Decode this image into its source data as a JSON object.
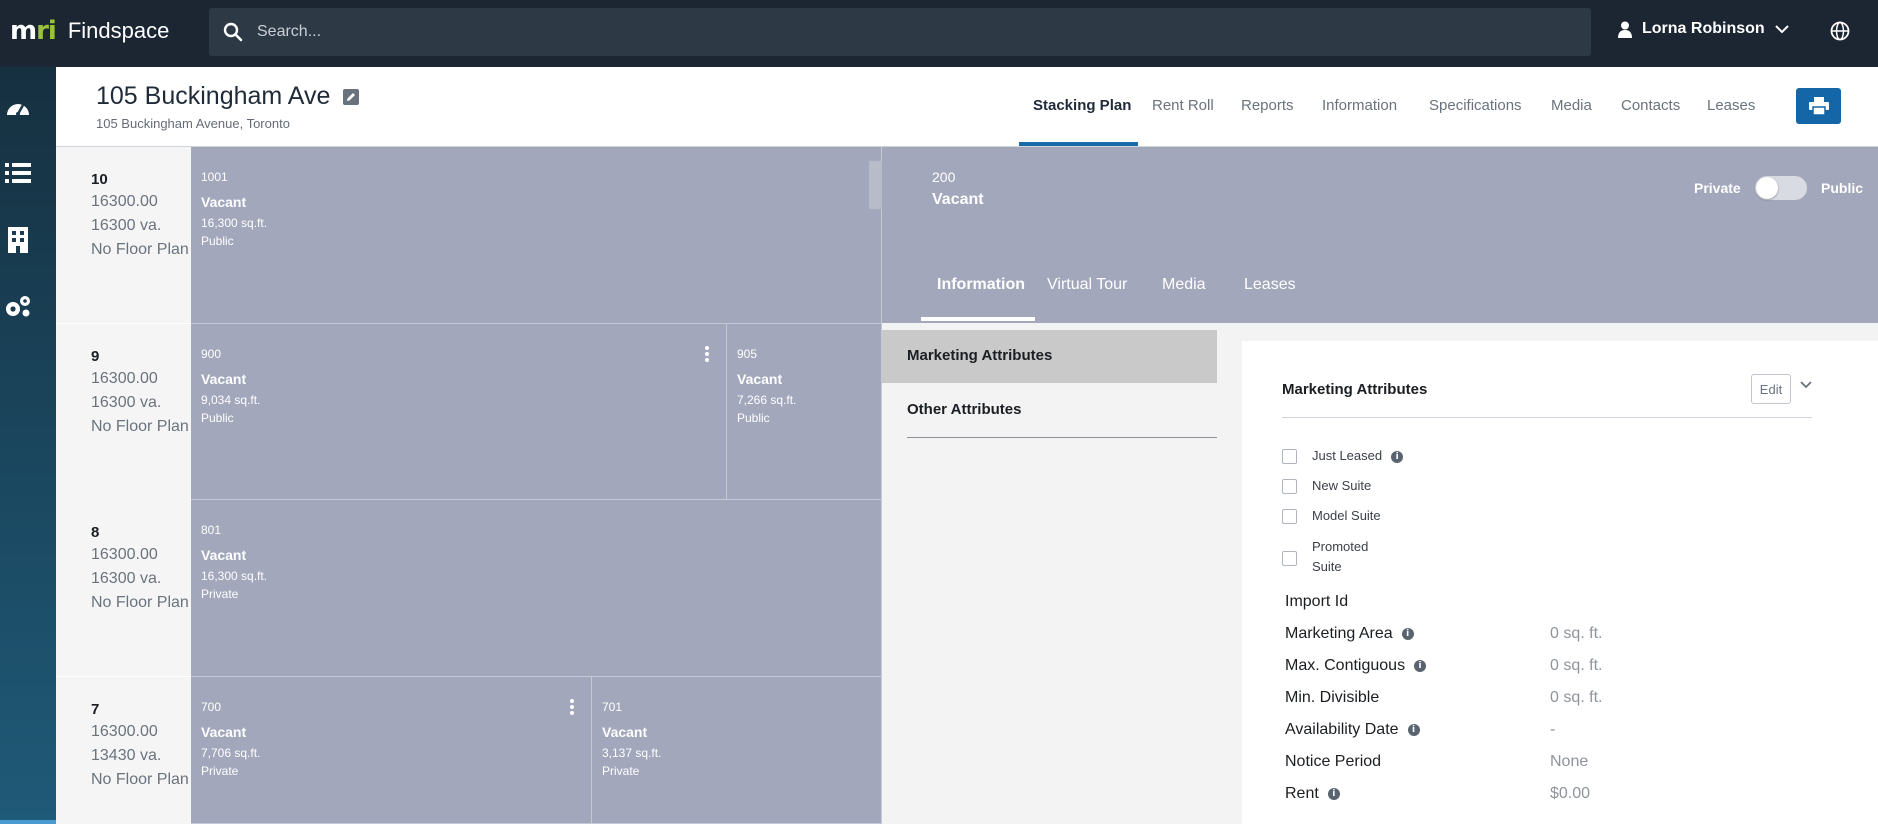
{
  "app": {
    "logo_mark": "mri",
    "name": "Findspace"
  },
  "search": {
    "placeholder": "Search..."
  },
  "user": {
    "name": "Lorna Robinson"
  },
  "nav_rail": [
    {
      "icon": "dashboard-icon"
    },
    {
      "icon": "list-icon"
    },
    {
      "icon": "building-icon"
    },
    {
      "icon": "settings-icon"
    }
  ],
  "property": {
    "title": "105 Buckingham Ave",
    "address": "105 Buckingham Avenue, Toronto"
  },
  "tabs": [
    {
      "label": "Stacking Plan",
      "active": true
    },
    {
      "label": "Rent Roll"
    },
    {
      "label": "Reports"
    },
    {
      "label": "Information"
    },
    {
      "label": "Specifications"
    },
    {
      "label": "Media"
    },
    {
      "label": "Contacts"
    },
    {
      "label": "Leases"
    }
  ],
  "floors": [
    {
      "number": "10",
      "area": "16300.00",
      "va": "16300 va.",
      "plan": "No Floor Plan"
    },
    {
      "number": "9",
      "area": "16300.00",
      "va": "16300 va.",
      "plan": "No Floor Plan"
    },
    {
      "number": "8",
      "area": "16300.00",
      "va": "16300 va.",
      "plan": "No Floor Plan"
    },
    {
      "number": "7",
      "area": "16300.00",
      "va": "13430 va.",
      "plan": "No Floor Plan"
    }
  ],
  "suites": [
    {
      "id": "1001",
      "status": "Vacant",
      "area": "16,300 sq.ft.",
      "visibility": "Public"
    },
    {
      "id": "900",
      "status": "Vacant",
      "area": "9,034 sq.ft.",
      "visibility": "Public"
    },
    {
      "id": "905",
      "status": "Vacant",
      "area": "7,266 sq.ft.",
      "visibility": "Public"
    },
    {
      "id": "801",
      "status": "Vacant",
      "area": "16,300 sq.ft.",
      "visibility": "Private"
    },
    {
      "id": "700",
      "status": "Vacant",
      "area": "7,706 sq.ft.",
      "visibility": "Private"
    },
    {
      "id": "701",
      "status": "Vacant",
      "area": "3,137 sq.ft.",
      "visibility": "Private"
    }
  ],
  "detail": {
    "suite_id": "200",
    "status": "Vacant",
    "toggle_left": "Private",
    "toggle_right": "Public",
    "toggle_public": false,
    "tabs": [
      {
        "label": "Information",
        "active": true
      },
      {
        "label": "Virtual Tour"
      },
      {
        "label": "Media"
      },
      {
        "label": "Leases"
      }
    ],
    "side_nav": [
      {
        "label": "Marketing Attributes",
        "active": true
      },
      {
        "label": "Other Attributes"
      }
    ],
    "card": {
      "title": "Marketing Attributes",
      "edit_label": "Edit",
      "checkboxes": [
        {
          "label": "Just Leased",
          "checked": false,
          "info": true
        },
        {
          "label": "New Suite",
          "checked": false
        },
        {
          "label": "Model Suite",
          "checked": false
        },
        {
          "label": "Promoted Suite",
          "checked": false
        }
      ],
      "fields": [
        {
          "label": "Import Id",
          "value": ""
        },
        {
          "label": "Marketing Area",
          "value": "0 sq. ft.",
          "info": true
        },
        {
          "label": "Max. Contiguous",
          "value": "0 sq. ft.",
          "info": true
        },
        {
          "label": "Min. Divisible",
          "value": "0 sq. ft."
        },
        {
          "label": "Availability Date",
          "value": "-",
          "info": true
        },
        {
          "label": "Notice Period",
          "value": "None"
        },
        {
          "label": "Rent",
          "value": "$0.00",
          "info": true
        }
      ]
    }
  },
  "colors": {
    "topbar": "#1b2632",
    "accent": "#1566a6",
    "suite_fill": "#a2a7bb",
    "brand_green": "#9ac33b"
  }
}
